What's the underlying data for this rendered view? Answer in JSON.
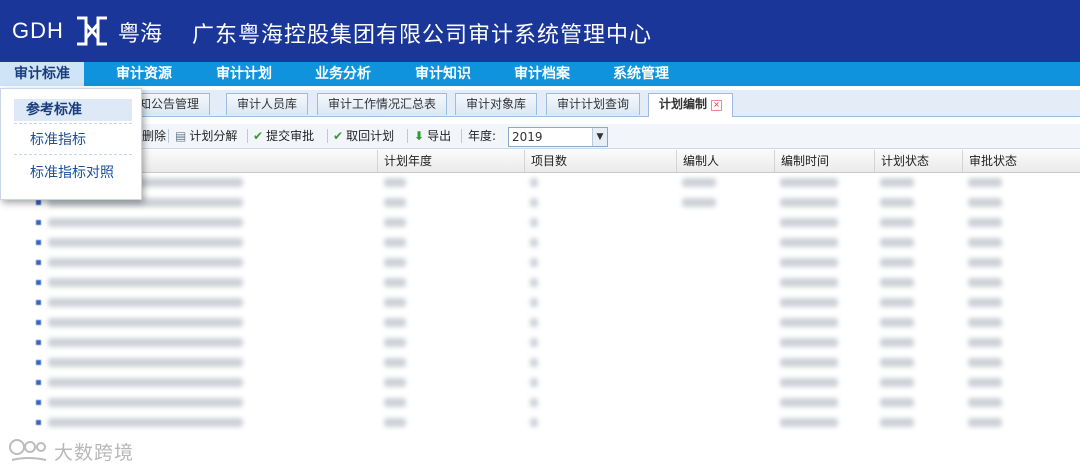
{
  "header": {
    "brand_en": "GDH",
    "brand_cn": "粤海",
    "title": "广东粤海控股集团有限公司审计系统管理中心",
    "bg_color": "#1a3699"
  },
  "nav": {
    "items": [
      "审计标准",
      "审计资源",
      "审计计划",
      "业务分析",
      "审计知识",
      "审计档案",
      "系统管理"
    ],
    "active": "审计标准"
  },
  "dropdown": {
    "items": [
      "参考标准",
      "标准指标",
      "标准指标对照"
    ],
    "selected": "参考标准"
  },
  "tabs": {
    "items": [
      "通知公告管理",
      "审计人员库",
      "审计工作情况汇总表",
      "审计对象库",
      "审计计划查询",
      "计划编制"
    ],
    "visible_fragment": "知公告管理",
    "active": "计划编制"
  },
  "toolbar": {
    "delete": "删除",
    "split": "计划分解",
    "submit": "提交审批",
    "withdraw": "取回计划",
    "export": "导出",
    "year_label": "年度:",
    "year_value": "2019"
  },
  "grid": {
    "columns": [
      "计划年度",
      "项目数",
      "编制人",
      "编制时间",
      "计划状态",
      "审批状态"
    ],
    "row_count": 13
  },
  "watermark": {
    "text": "大数跨境"
  },
  "colors": {
    "header": "#1a3699",
    "nav": "#0e93dc",
    "accent": "#1d4f99"
  }
}
